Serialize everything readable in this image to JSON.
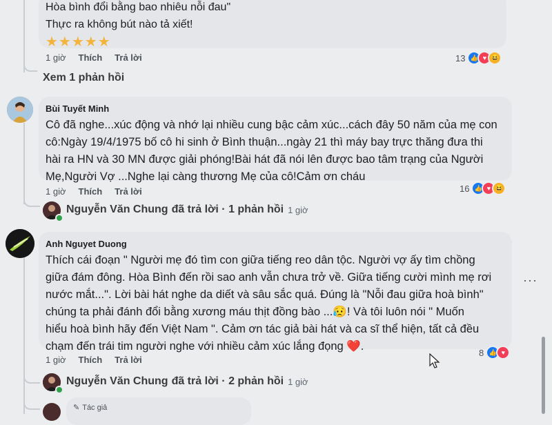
{
  "comment0": {
    "lines": [
      "Hòa bình đổi bằng bao nhiêu nỗi đau\"",
      "Thực ra không bút nào tả xiết!"
    ],
    "stars": "★★★★★",
    "time": "1 giờ",
    "like": "Thích",
    "reply": "Trả lời",
    "reaction_count": "13"
  },
  "view_replies": "Xem 1 phản hồi",
  "comment1": {
    "author": "Bùi Tuyết Minh",
    "lines": [
      "Cô đã nghe...xúc động và nhớ lại nhiều cung bậc cảm xúc...cách đây 50 năm của mẹ con",
      "cô:Ngày 19/4/1975 bố cô hi sinh ở Bình thuận...ngày 21 thì máy bay trực thăng đưa thi",
      "hài ra HN và 30 MN được giải phóng!Bài hát đã nói lên được bao tâm trạng của Người",
      "Mẹ,Người Vợ ...Nghe lại càng thương Mẹ của cô!Cảm ơn cháu"
    ],
    "time": "1 giờ",
    "like": "Thích",
    "reply": "Trả lời",
    "reaction_count": "16",
    "reply_summary": {
      "name": "Nguyễn Văn Chung",
      "text": "đã trả lời · 1 phản hồi",
      "time": "1 giờ"
    }
  },
  "comment2": {
    "author": "Anh Nguyet Duong",
    "lines": [
      "Thích cái đoạn \" Người mẹ đó tìm con giữa tiếng reo dân tộc. Người vợ ấy tìm chồng",
      "giữa đám đông. Hòa Bình đến rồi sao anh vẫn chưa trở về. Giữa tiếng cười mình mẹ rơi",
      "nước mắt...\". Lời bài hát nghe da diết và sâu sắc quá. Đúng là \"Nỗi đau giữa hoà bình\"",
      "chúng ta phải đánh đổi bằng xương máu thịt đồng bào ...😥! Và tôi luôn nói \" Muốn",
      "hiểu hoà bình hãy đến Việt Nam \". Cảm ơn tác giả bài hát và ca sĩ thể hiện, tất cả đều",
      "chạm đến trái tim người nghe với nhiều cảm xúc lắng đọng ❤️."
    ],
    "time": "1 giờ",
    "like": "Thích",
    "reply": "Trả lời",
    "reaction_count": "8",
    "more": "···",
    "reply_summary": {
      "name": "Nguyễn Văn Chung",
      "text": "đã trả lời · 2 phản hồi",
      "time": "1 giờ"
    }
  },
  "author_badge": "Tác giả",
  "colors": {
    "background": "#ecedef",
    "bubble": "#e4e6ea",
    "like": "#1877f2",
    "love": "#f33e58",
    "haha": "#f7b125"
  }
}
